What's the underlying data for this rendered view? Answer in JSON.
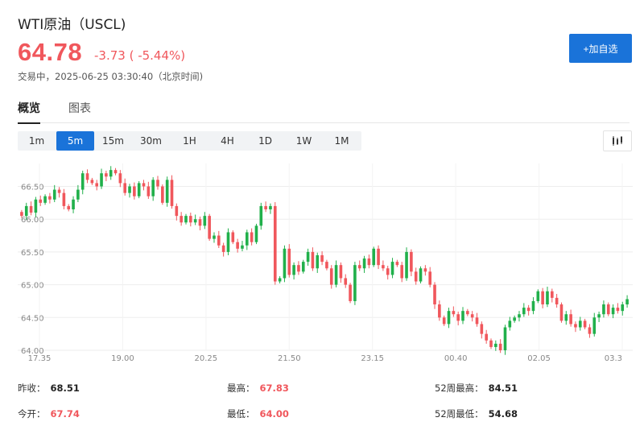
{
  "header": {
    "title": "WTI原油（USCL)",
    "price": "64.78",
    "change": "-3.73 ( -5.44%)",
    "status": "交易中，2025-06-25 03:30:40（北京时间)",
    "add_button": "+加自选"
  },
  "tabs": [
    "概览",
    "图表"
  ],
  "ranges": [
    "1m",
    "5m",
    "15m",
    "30m",
    "1H",
    "4H",
    "1D",
    "1W",
    "1M"
  ],
  "active_range": "5m",
  "colors": {
    "up": "#21b04b",
    "down": "#f0575c",
    "accent": "#1a73d9",
    "price": "#f0575c"
  },
  "icons": {
    "chart_type": "candlestick-chart-icon"
  },
  "stats": {
    "prev_close_label": "昨收：",
    "prev_close": "68.51",
    "open_label": "今开：",
    "open": "67.74",
    "high_label": "最高：",
    "high": "67.83",
    "low_label": "最低：",
    "low": "64.00",
    "high52_label": "52周最高：",
    "high52": "84.51",
    "low52_label": "52周最低：",
    "low52": "54.68"
  },
  "chart_data": {
    "type": "candlestick",
    "y_ticks": [
      "66.50",
      "66.00",
      "65.50",
      "65.00",
      "64.50",
      "64.00"
    ],
    "x_ticks": [
      "17.35",
      "19.00",
      "20.25",
      "21.50",
      "23.15",
      "00.40",
      "02.05",
      "03.3"
    ],
    "ylim": [
      64.0,
      66.85
    ],
    "grid": true,
    "closes": [
      66.05,
      66.2,
      66.1,
      66.3,
      66.25,
      66.35,
      66.3,
      66.45,
      66.4,
      66.2,
      66.15,
      66.3,
      66.45,
      66.7,
      66.6,
      66.55,
      66.5,
      66.7,
      66.65,
      66.75,
      66.7,
      66.55,
      66.4,
      66.5,
      66.35,
      66.55,
      66.5,
      66.35,
      66.6,
      66.5,
      66.25,
      66.6,
      66.2,
      66.05,
      65.95,
      66.05,
      65.95,
      66.0,
      65.9,
      66.05,
      65.7,
      65.75,
      65.6,
      65.5,
      65.8,
      65.65,
      65.55,
      65.6,
      65.8,
      65.65,
      65.9,
      66.2,
      66.15,
      66.2,
      65.05,
      65.1,
      65.55,
      65.15,
      65.3,
      65.2,
      65.35,
      65.5,
      65.25,
      65.45,
      65.35,
      65.25,
      65.0,
      65.3,
      65.1,
      65.0,
      64.75,
      65.3,
      65.25,
      65.4,
      65.3,
      65.55,
      65.3,
      65.25,
      65.15,
      65.35,
      65.3,
      65.1,
      65.5,
      65.2,
      65.05,
      65.25,
      65.2,
      65.0,
      64.7,
      64.5,
      64.4,
      64.6,
      64.55,
      64.45,
      64.6,
      64.55,
      64.5,
      64.4,
      64.25,
      64.15,
      64.05,
      64.1,
      64.0,
      64.35,
      64.45,
      64.5,
      64.55,
      64.65,
      64.6,
      64.75,
      64.9,
      64.7,
      64.9,
      64.8,
      64.7,
      64.45,
      64.55,
      64.4,
      64.35,
      64.45,
      64.35,
      64.25,
      64.5,
      64.55,
      64.7,
      64.55,
      64.65,
      64.6,
      64.7,
      64.78
    ]
  }
}
